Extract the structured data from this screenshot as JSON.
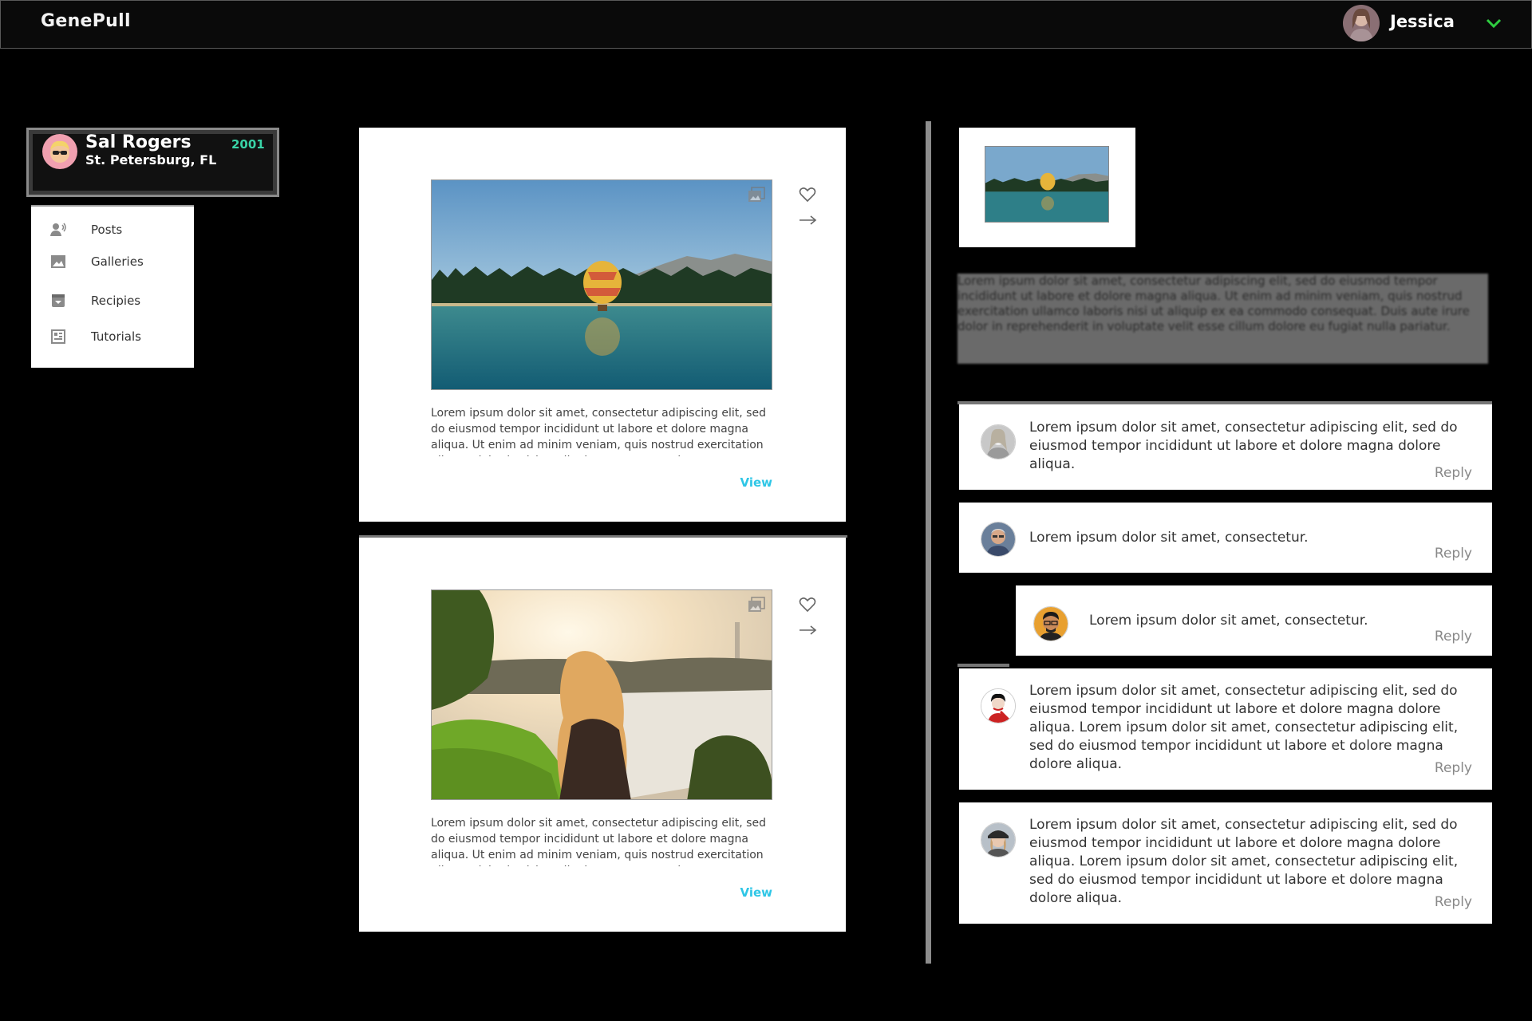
{
  "app": {
    "brand": "GenePull"
  },
  "user": {
    "name": "Jessica"
  },
  "profile": {
    "name": "Sal Rogers",
    "location": "St. Petersburg, FL",
    "year": "2001"
  },
  "menu": {
    "items": [
      {
        "label": "Posts",
        "icon": "posts-icon"
      },
      {
        "label": "Galleries",
        "icon": "image-icon"
      },
      {
        "label": "Recipies",
        "icon": "recipe-icon"
      },
      {
        "label": "Tutorials",
        "icon": "tutorial-icon"
      }
    ]
  },
  "posts": [
    {
      "text": "Lorem ipsum dolor sit amet, consectetur adipiscing elit, sed do eiusmod tempor incididunt ut labore et dolore magna aliqua. Ut enim ad minim veniam, quis nostrud exercitation ullamco laboris nisi ut aliquip ex ea commodo consequat.",
      "view_label": "View"
    },
    {
      "text": "Lorem ipsum dolor sit amet, consectetur adipiscing elit, sed do eiusmod tempor incididunt ut labore et dolore magna aliqua. Ut enim ad minim veniam, quis nostrud exercitation ullamco laboris nisi ut aliquip ex ea commodo consequat.",
      "view_label": "View"
    }
  ],
  "preview": {
    "description": "Lorem ipsum dolor sit amet, consectetur adipiscing elit, sed do eiusmod tempor incididunt ut labore et dolore magna aliqua. Ut enim ad minim veniam, quis nostrud exercitation ullamco laboris nisi ut aliquip ex ea commodo consequat. Duis aute irure dolor in reprehenderit in voluptate velit esse cillum dolore eu fugiat nulla pariatur."
  },
  "comments": [
    {
      "text": "Lorem ipsum dolor sit amet, consectetur adipiscing elit, sed do eiusmod tempor incididunt ut labore et dolore magna dolore aliqua.",
      "reply_label": "Reply"
    },
    {
      "text": "Lorem ipsum dolor sit amet, consectetur.",
      "reply_label": "Reply"
    },
    {
      "text": "Lorem ipsum dolor sit amet, consectetur.",
      "reply_label": "Reply"
    },
    {
      "text": "Lorem ipsum dolor sit amet, consectetur adipiscing elit, sed do eiusmod tempor incididunt ut labore et dolore magna dolore aliqua. Lorem ipsum dolor sit amet, consectetur adipiscing elit, sed do eiusmod tempor incididunt ut labore et dolore magna dolore aliqua.",
      "reply_label": "Reply"
    },
    {
      "text": "Lorem ipsum dolor sit amet, consectetur adipiscing elit, sed do eiusmod tempor incididunt ut labore et dolore magna dolore aliqua. Lorem ipsum dolor sit amet, consectetur adipiscing elit, sed do eiusmod tempor incididunt ut labore et dolore magna dolore aliqua.",
      "reply_label": "Reply"
    }
  ],
  "colors": {
    "accent": "#2ec6e6",
    "year": "#39d3a7",
    "chevron": "#2ecc40"
  }
}
